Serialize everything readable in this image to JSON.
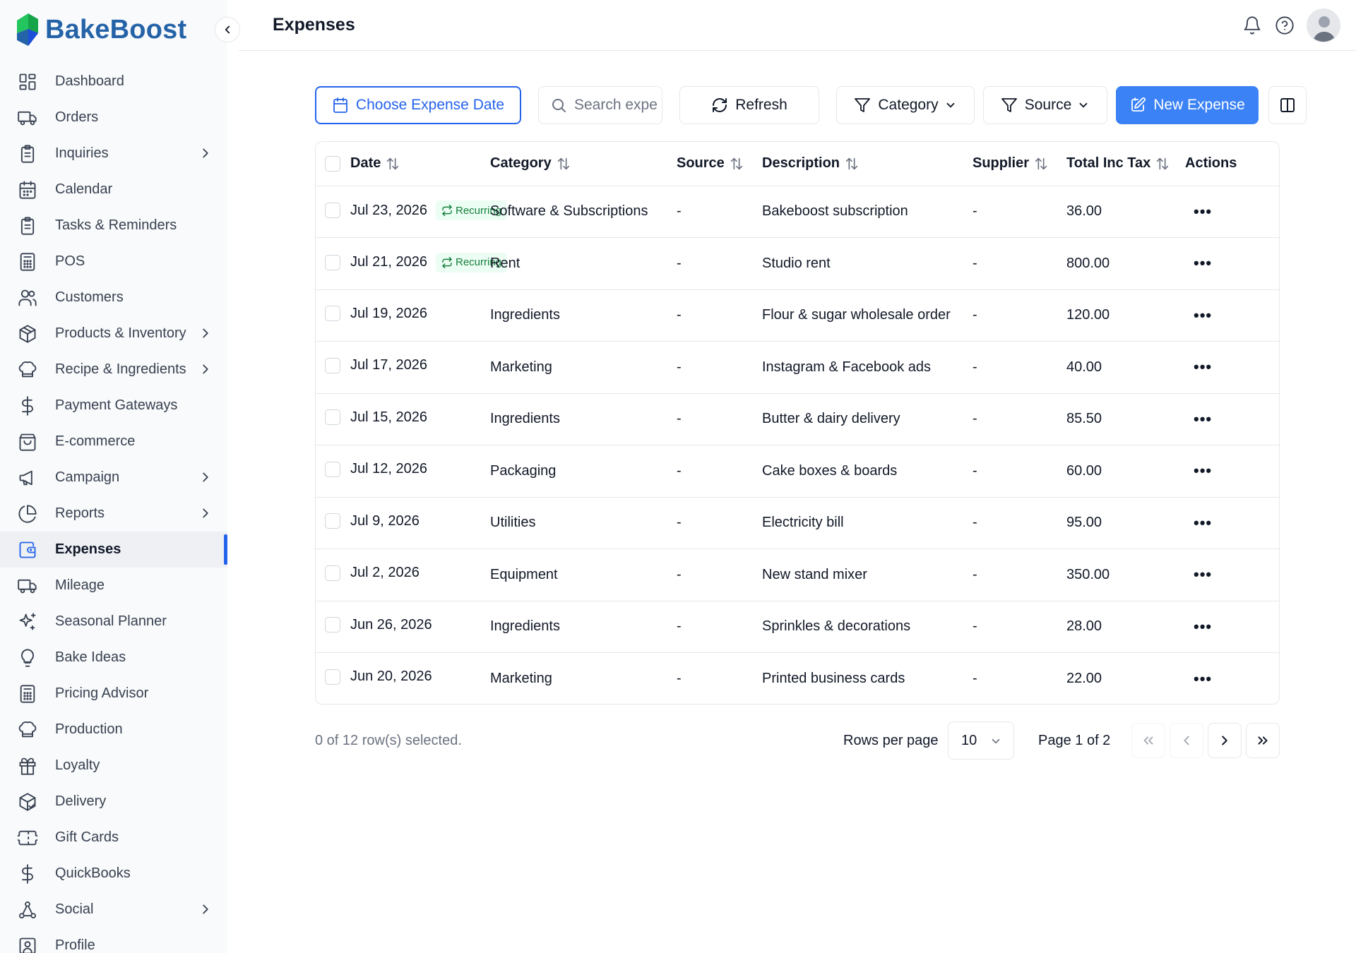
{
  "app": {
    "name": "BakeBoost"
  },
  "header": {
    "title": "Expenses"
  },
  "sidebar": {
    "items": [
      {
        "label": "Dashboard",
        "icon": "dashboard-icon",
        "chevron": false,
        "active": false
      },
      {
        "label": "Orders",
        "icon": "truck-icon",
        "chevron": false,
        "active": false
      },
      {
        "label": "Inquiries",
        "icon": "clipboard-icon",
        "chevron": true,
        "active": false
      },
      {
        "label": "Calendar",
        "icon": "calendar-icon",
        "chevron": false,
        "active": false
      },
      {
        "label": "Tasks & Reminders",
        "icon": "clipboard-icon",
        "chevron": false,
        "active": false
      },
      {
        "label": "POS",
        "icon": "calculator-icon",
        "chevron": false,
        "active": false
      },
      {
        "label": "Customers",
        "icon": "users-icon",
        "chevron": false,
        "active": false
      },
      {
        "label": "Products & Inventory",
        "icon": "package-icon",
        "chevron": true,
        "active": false
      },
      {
        "label": "Recipe & Ingredients",
        "icon": "chef-hat-icon",
        "chevron": true,
        "active": false
      },
      {
        "label": "Payment Gateways",
        "icon": "dollar-icon",
        "chevron": false,
        "active": false
      },
      {
        "label": "E-commerce",
        "icon": "shopping-bag-icon",
        "chevron": false,
        "active": false
      },
      {
        "label": "Campaign",
        "icon": "megaphone-icon",
        "chevron": true,
        "active": false
      },
      {
        "label": "Reports",
        "icon": "pie-chart-icon",
        "chevron": true,
        "active": false
      },
      {
        "label": "Expenses",
        "icon": "wallet-icon",
        "chevron": false,
        "active": true
      },
      {
        "label": "Mileage",
        "icon": "truck-icon",
        "chevron": false,
        "active": false
      },
      {
        "label": "Seasonal Planner",
        "icon": "sparkles-icon",
        "chevron": false,
        "active": false
      },
      {
        "label": "Bake Ideas",
        "icon": "lightbulb-icon",
        "chevron": false,
        "active": false
      },
      {
        "label": "Pricing Advisor",
        "icon": "calculator-icon",
        "chevron": false,
        "active": false
      },
      {
        "label": "Production",
        "icon": "chef-hat-icon",
        "chevron": false,
        "active": false
      },
      {
        "label": "Loyalty",
        "icon": "gift-icon",
        "chevron": false,
        "active": false
      },
      {
        "label": "Delivery",
        "icon": "package-check-icon",
        "chevron": false,
        "active": false
      },
      {
        "label": "Gift Cards",
        "icon": "ticket-icon",
        "chevron": false,
        "active": false
      },
      {
        "label": "QuickBooks",
        "icon": "dollar-icon",
        "chevron": false,
        "active": false
      },
      {
        "label": "Social",
        "icon": "share-nodes-icon",
        "chevron": true,
        "active": false
      },
      {
        "label": "Profile",
        "icon": "user-square-icon",
        "chevron": false,
        "active": false
      }
    ]
  },
  "toolbar": {
    "date_label": "Choose Expense Date",
    "search_placeholder": "Search expenses...",
    "refresh_label": "Refresh",
    "category_label": "Category",
    "source_label": "Source",
    "new_label": "New Expense",
    "accent": "#3b82f6"
  },
  "table": {
    "columns": [
      "Date",
      "Category",
      "Source",
      "Description",
      "Supplier",
      "Total Inc Tax",
      "Actions"
    ],
    "rows": [
      {
        "date": "Jul 23, 2026",
        "recurring": "Recurring",
        "category": "Software & Subscriptions",
        "source": "-",
        "description": "Bakeboost subscription",
        "supplier": "-",
        "total": "36.00"
      },
      {
        "date": "Jul 21, 2026",
        "recurring": "Recurring",
        "category": "Rent",
        "source": "-",
        "description": "Studio rent",
        "supplier": "-",
        "total": "800.00"
      },
      {
        "date": "Jul 19, 2026",
        "recurring": "",
        "category": "Ingredients",
        "source": "-",
        "description": "Flour & sugar wholesale order",
        "supplier": "-",
        "total": "120.00"
      },
      {
        "date": "Jul 17, 2026",
        "recurring": "",
        "category": "Marketing",
        "source": "-",
        "description": "Instagram & Facebook ads",
        "supplier": "-",
        "total": "40.00"
      },
      {
        "date": "Jul 15, 2026",
        "recurring": "",
        "category": "Ingredients",
        "source": "-",
        "description": "Butter & dairy delivery",
        "supplier": "-",
        "total": "85.50"
      },
      {
        "date": "Jul 12, 2026",
        "recurring": "",
        "category": "Packaging",
        "source": "-",
        "description": "Cake boxes & boards",
        "supplier": "-",
        "total": "60.00"
      },
      {
        "date": "Jul 9, 2026",
        "recurring": "",
        "category": "Utilities",
        "source": "-",
        "description": "Electricity bill",
        "supplier": "-",
        "total": "95.00"
      },
      {
        "date": "Jul 2, 2026",
        "recurring": "",
        "category": "Equipment",
        "source": "-",
        "description": "New stand mixer",
        "supplier": "-",
        "total": "350.00"
      },
      {
        "date": "Jun 26, 2026",
        "recurring": "",
        "category": "Ingredients",
        "source": "-",
        "description": "Sprinkles & decorations",
        "supplier": "-",
        "total": "28.00"
      },
      {
        "date": "Jun 20, 2026",
        "recurring": "",
        "category": "Marketing",
        "source": "-",
        "description": "Printed business cards",
        "supplier": "-",
        "total": "22.00"
      }
    ],
    "actions_glyph": "•••"
  },
  "footer": {
    "selected_text": "0 of 12 row(s) selected.",
    "rows_per_page_label": "Rows per page",
    "rows_per_page_value": "10",
    "page_text": "Page 1 of 2"
  }
}
